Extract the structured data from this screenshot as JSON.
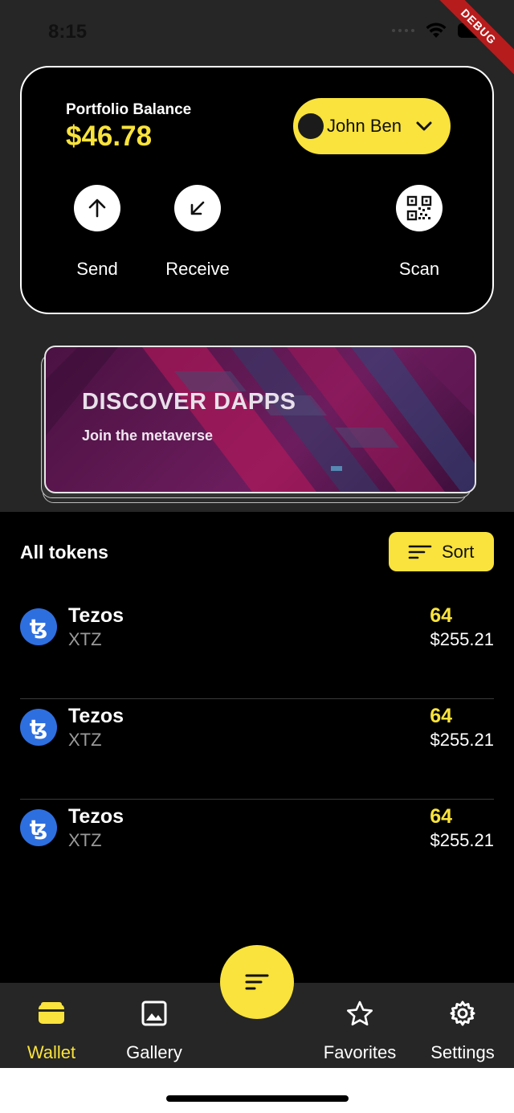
{
  "status": {
    "time": "8:15",
    "debug": "DEBUG"
  },
  "portfolio": {
    "label": "Portfolio Balance",
    "balance": "$46.78",
    "account_name": "John Ben",
    "actions": [
      {
        "label": "Send",
        "icon": "arrow-up-icon"
      },
      {
        "label": "Receive",
        "icon": "arrow-down-left-icon"
      },
      {
        "label": "Scan",
        "icon": "qr-code-icon"
      }
    ]
  },
  "banner": {
    "title": "DISCOVER DAPPS",
    "subtitle": "Join the metaverse"
  },
  "tokens": {
    "title": "All tokens",
    "sort_label": "Sort",
    "items": [
      {
        "name": "Tezos",
        "symbol": "XTZ",
        "amount": "64",
        "value": "$255.21"
      },
      {
        "name": "Tezos",
        "symbol": "XTZ",
        "amount": "64",
        "value": "$255.21"
      },
      {
        "name": "Tezos",
        "symbol": "XTZ",
        "amount": "64",
        "value": "$255.21"
      }
    ]
  },
  "nav": {
    "items": [
      {
        "label": "Wallet",
        "icon": "wallet-icon",
        "active": true
      },
      {
        "label": "Gallery",
        "icon": "gallery-icon",
        "active": false
      },
      {
        "label": "Favorites",
        "icon": "star-icon",
        "active": false
      },
      {
        "label": "Settings",
        "icon": "gear-icon",
        "active": false
      }
    ]
  },
  "colors": {
    "accent": "#f9e33c",
    "background": "#262626",
    "card": "#000000",
    "token_icon": "#2e6fe0"
  }
}
